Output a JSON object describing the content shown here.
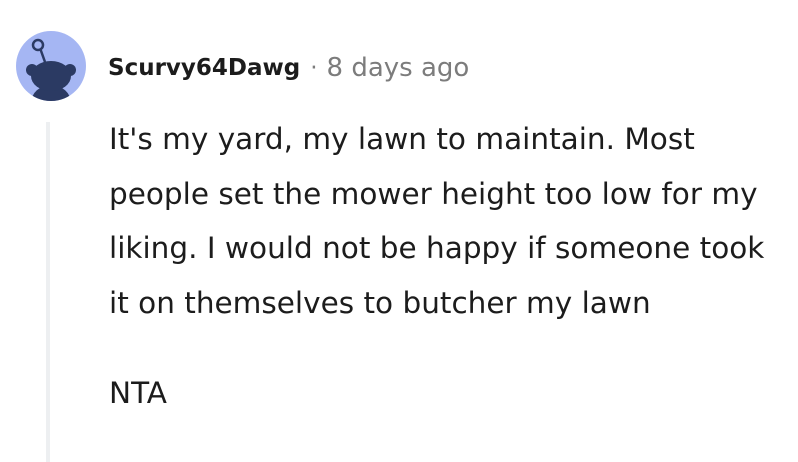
{
  "comment": {
    "author": "Scurvy64Dawg",
    "separator": "·",
    "timestamp": "8 days ago",
    "avatar_icon": "snoo-avatar-icon",
    "avatar_bg": "#a5b6f3",
    "paragraphs": [
      "It's my yard, my lawn to maintain. Most people set the mower height too low for my liking. I would not be happy if someone took it on themselves to butcher my lawn",
      "NTA"
    ]
  }
}
